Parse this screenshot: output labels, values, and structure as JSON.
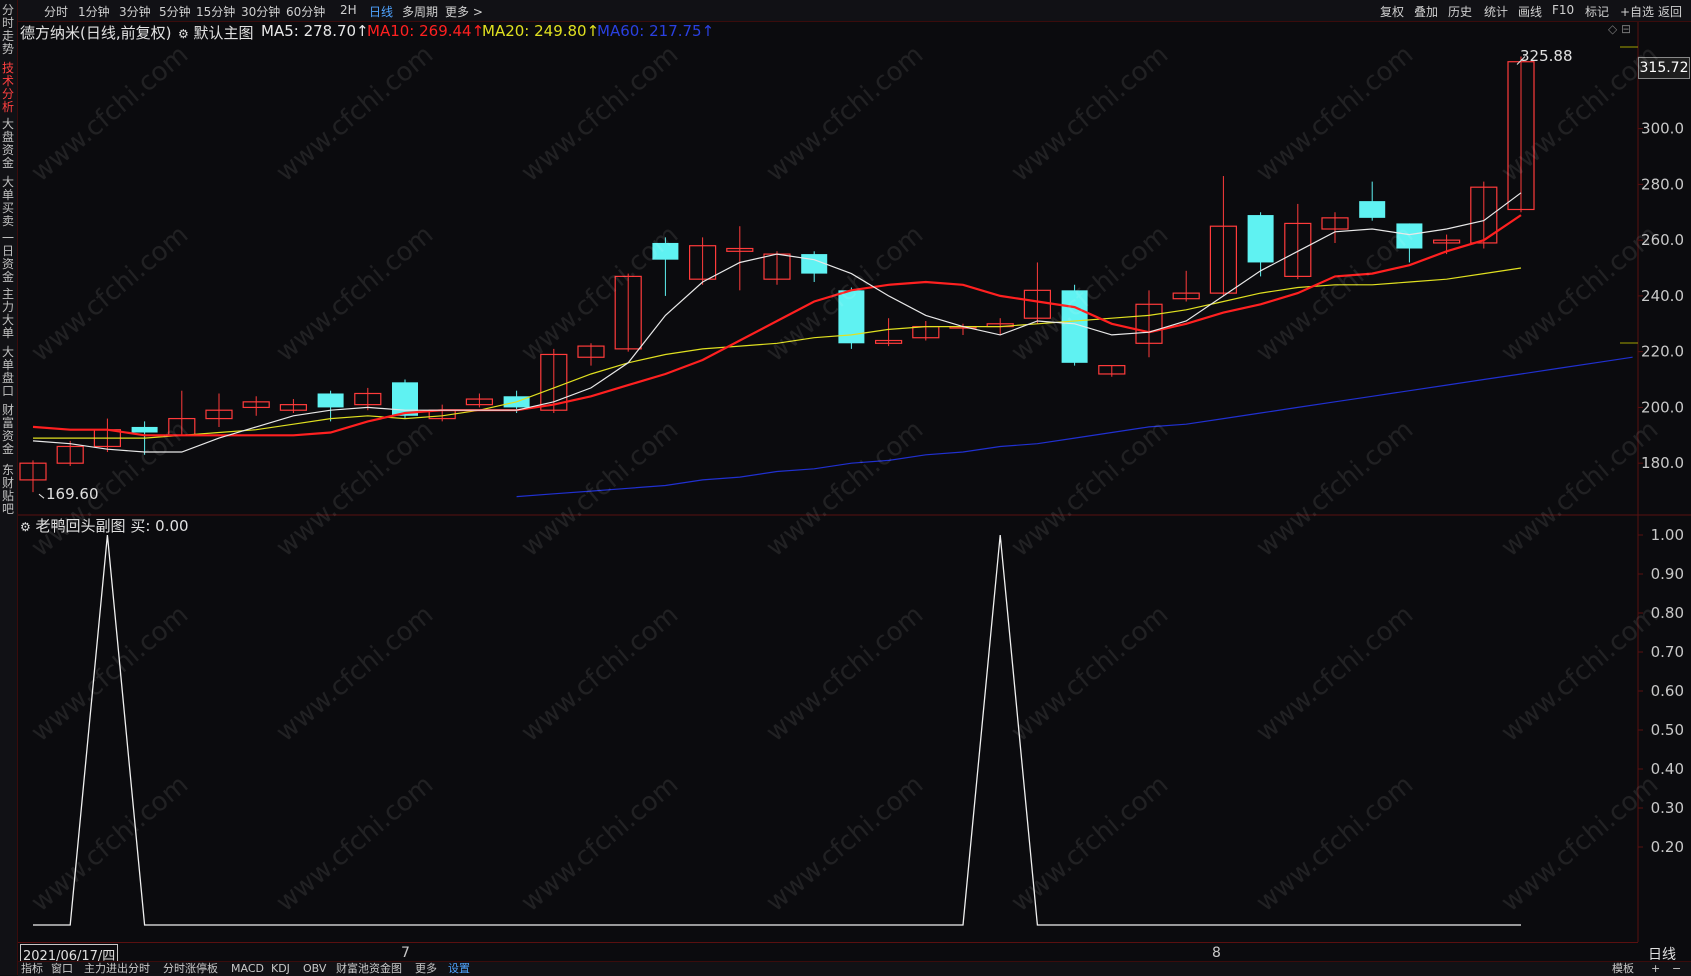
{
  "left_tabs": [
    "分时走势",
    "技术分析",
    "大盘资金",
    "大单买卖",
    "一日资金",
    "主力大单",
    "大单盘口",
    "财富资金",
    "东财贴吧"
  ],
  "left_tabs_active": 1,
  "toolbar": {
    "periods": [
      "分时",
      "1分钟",
      "3分钟",
      "5分钟",
      "15分钟",
      "30分钟",
      "60分钟",
      "2H",
      "日线",
      "多周期",
      "更多 >"
    ],
    "active_period": "日线",
    "right": [
      "复权",
      "叠加",
      "历史",
      "统计",
      "画线",
      "F10",
      "标记",
      "+自选",
      "返回"
    ]
  },
  "main_legend": {
    "title": "德方纳米(日线,前复权)",
    "chart_name": "默认主图",
    "ma5": "MA5: 278.70↑",
    "ma10": "MA10: 269.44↑",
    "ma20": "MA20: 249.80↑",
    "ma60": "MA60: 217.75↑"
  },
  "sub_legend": {
    "title": "老鸭回头副图",
    "buy": "买: 0.00"
  },
  "annotations": {
    "high": "325.88",
    "low": "169.60",
    "current_price": "315.72"
  },
  "date_box": "2021/06/17/四",
  "month_labels": [
    "7",
    "8"
  ],
  "bottom_bar": {
    "items": [
      "指标",
      "窗口",
      "主力进出分时",
      "分时涨停板",
      "MACD",
      "KDJ",
      "OBV",
      "财富池资金图",
      "更多",
      "设置"
    ],
    "right": [
      "模板",
      "+",
      "−"
    ],
    "period_label": "日线"
  },
  "colors": {
    "up": "#ff3b3b",
    "down": "#5ff2f2",
    "ma5": "#e8e8e8",
    "ma10": "#ff2020",
    "ma20": "#e0e020",
    "ma60": "#2030d0",
    "grid": "#5a1010",
    "bg": "#0b0b0e"
  },
  "chart_data": [
    {
      "type": "candlestick",
      "name": "德方纳米 日线",
      "ylim": [
        165,
        330
      ],
      "y_ticks": [
        180,
        200,
        220,
        240,
        260,
        280,
        300
      ],
      "candles": [
        {
          "o": 174,
          "c": 180,
          "h": 181,
          "l": 169.6
        },
        {
          "o": 180,
          "c": 186,
          "h": 188,
          "l": 179
        },
        {
          "o": 186,
          "c": 192,
          "h": 196,
          "l": 184
        },
        {
          "o": 193,
          "c": 191,
          "h": 195,
          "l": 183
        },
        {
          "o": 190,
          "c": 196,
          "h": 206,
          "l": 190
        },
        {
          "o": 196,
          "c": 199,
          "h": 205,
          "l": 193
        },
        {
          "o": 200,
          "c": 202,
          "h": 204,
          "l": 197
        },
        {
          "o": 199,
          "c": 201,
          "h": 203,
          "l": 198
        },
        {
          "o": 205,
          "c": 200,
          "h": 206,
          "l": 195
        },
        {
          "o": 201,
          "c": 205,
          "h": 207,
          "l": 199
        },
        {
          "o": 209,
          "c": 197,
          "h": 210,
          "l": 196
        },
        {
          "o": 196,
          "c": 199,
          "h": 201,
          "l": 195
        },
        {
          "o": 201,
          "c": 203,
          "h": 205,
          "l": 200
        },
        {
          "o": 204,
          "c": 200,
          "h": 206,
          "l": 198
        },
        {
          "o": 199,
          "c": 219,
          "h": 221,
          "l": 198
        },
        {
          "o": 218,
          "c": 222,
          "h": 223,
          "l": 215
        },
        {
          "o": 221,
          "c": 247,
          "h": 248,
          "l": 220
        },
        {
          "o": 259,
          "c": 253,
          "h": 261,
          "l": 240
        },
        {
          "o": 246,
          "c": 258,
          "h": 261,
          "l": 244
        },
        {
          "o": 256,
          "c": 257,
          "h": 265,
          "l": 242
        },
        {
          "o": 246,
          "c": 255,
          "h": 256,
          "l": 244
        },
        {
          "o": 255,
          "c": 248,
          "h": 256,
          "l": 245
        },
        {
          "o": 242,
          "c": 223,
          "h": 243,
          "l": 221
        },
        {
          "o": 223,
          "c": 224,
          "h": 232,
          "l": 222
        },
        {
          "o": 225,
          "c": 229,
          "h": 231,
          "l": 224
        },
        {
          "o": 229,
          "c": 229,
          "h": 230,
          "l": 226
        },
        {
          "o": 229,
          "c": 230,
          "h": 232,
          "l": 226
        },
        {
          "o": 232,
          "c": 242,
          "h": 252,
          "l": 230
        },
        {
          "o": 242,
          "c": 216,
          "h": 244,
          "l": 215
        },
        {
          "o": 212,
          "c": 215,
          "h": 215,
          "l": 211
        },
        {
          "o": 223,
          "c": 237,
          "h": 242,
          "l": 218
        },
        {
          "o": 239,
          "c": 241,
          "h": 249,
          "l": 238
        },
        {
          "o": 241,
          "c": 265,
          "h": 283,
          "l": 240
        },
        {
          "o": 269,
          "c": 252,
          "h": 270,
          "l": 247
        },
        {
          "o": 247,
          "c": 266,
          "h": 273,
          "l": 246
        },
        {
          "o": 264,
          "c": 268,
          "h": 270,
          "l": 259
        },
        {
          "o": 274,
          "c": 268,
          "h": 281,
          "l": 267
        },
        {
          "o": 266,
          "c": 257,
          "h": 266,
          "l": 252
        },
        {
          "o": 259,
          "c": 260,
          "h": 262,
          "l": 255
        },
        {
          "o": 259,
          "c": 279,
          "h": 281,
          "l": 257
        },
        {
          "o": 271,
          "c": 324,
          "h": 325.88,
          "l": 270
        }
      ],
      "ma": {
        "MA5": [
          188,
          187,
          185,
          184,
          184,
          189,
          193,
          197,
          199,
          200,
          199,
          199,
          199,
          199,
          202,
          207,
          216,
          233,
          245,
          252,
          255,
          253,
          248,
          240,
          233,
          229,
          226,
          231,
          230,
          226,
          227,
          231,
          240,
          249,
          256,
          263,
          264,
          262,
          264,
          267,
          277
        ],
        "MA10": [
          193,
          192,
          192,
          190,
          190,
          190,
          190,
          190,
          191,
          195,
          198,
          199,
          199,
          199,
          201,
          204,
          208,
          212,
          217,
          224,
          231,
          238,
          242,
          244,
          245,
          244,
          240,
          238,
          236,
          230,
          227,
          230,
          234,
          237,
          241,
          247,
          248,
          251,
          256,
          260,
          269
        ],
        "MA20": [
          189,
          189,
          189,
          189,
          190,
          191,
          192,
          194,
          196,
          197,
          196,
          197,
          199,
          202,
          207,
          212,
          216,
          219,
          221,
          222,
          223,
          225,
          226,
          228,
          229,
          229,
          229,
          230,
          231,
          232,
          233,
          235,
          238,
          241,
          243,
          244,
          244,
          245,
          246,
          248,
          250
        ],
        "MA60": [
          168,
          169,
          170,
          171,
          172,
          174,
          175,
          177,
          178,
          180,
          181,
          183,
          184,
          186,
          187,
          189,
          191,
          193,
          194,
          196,
          198,
          200,
          202,
          204,
          206,
          208,
          210,
          212,
          214,
          216,
          218
        ]
      },
      "ma60_start_index": 13
    },
    {
      "type": "line",
      "name": "老鸭回头副图",
      "ylim": [
        0,
        1
      ],
      "y_ticks": [
        0.2,
        0.3,
        0.4,
        0.5,
        0.6,
        0.7,
        0.8,
        0.9,
        1.0
      ],
      "values": [
        0,
        0,
        1,
        0,
        0,
        0,
        0,
        0,
        0,
        0,
        0,
        0,
        0,
        0,
        0,
        0,
        0,
        0,
        0,
        0,
        0,
        0,
        0,
        0,
        0,
        0,
        1,
        0,
        0,
        0,
        0,
        0,
        0,
        0,
        0,
        0,
        0,
        0,
        0,
        0,
        0
      ]
    }
  ]
}
